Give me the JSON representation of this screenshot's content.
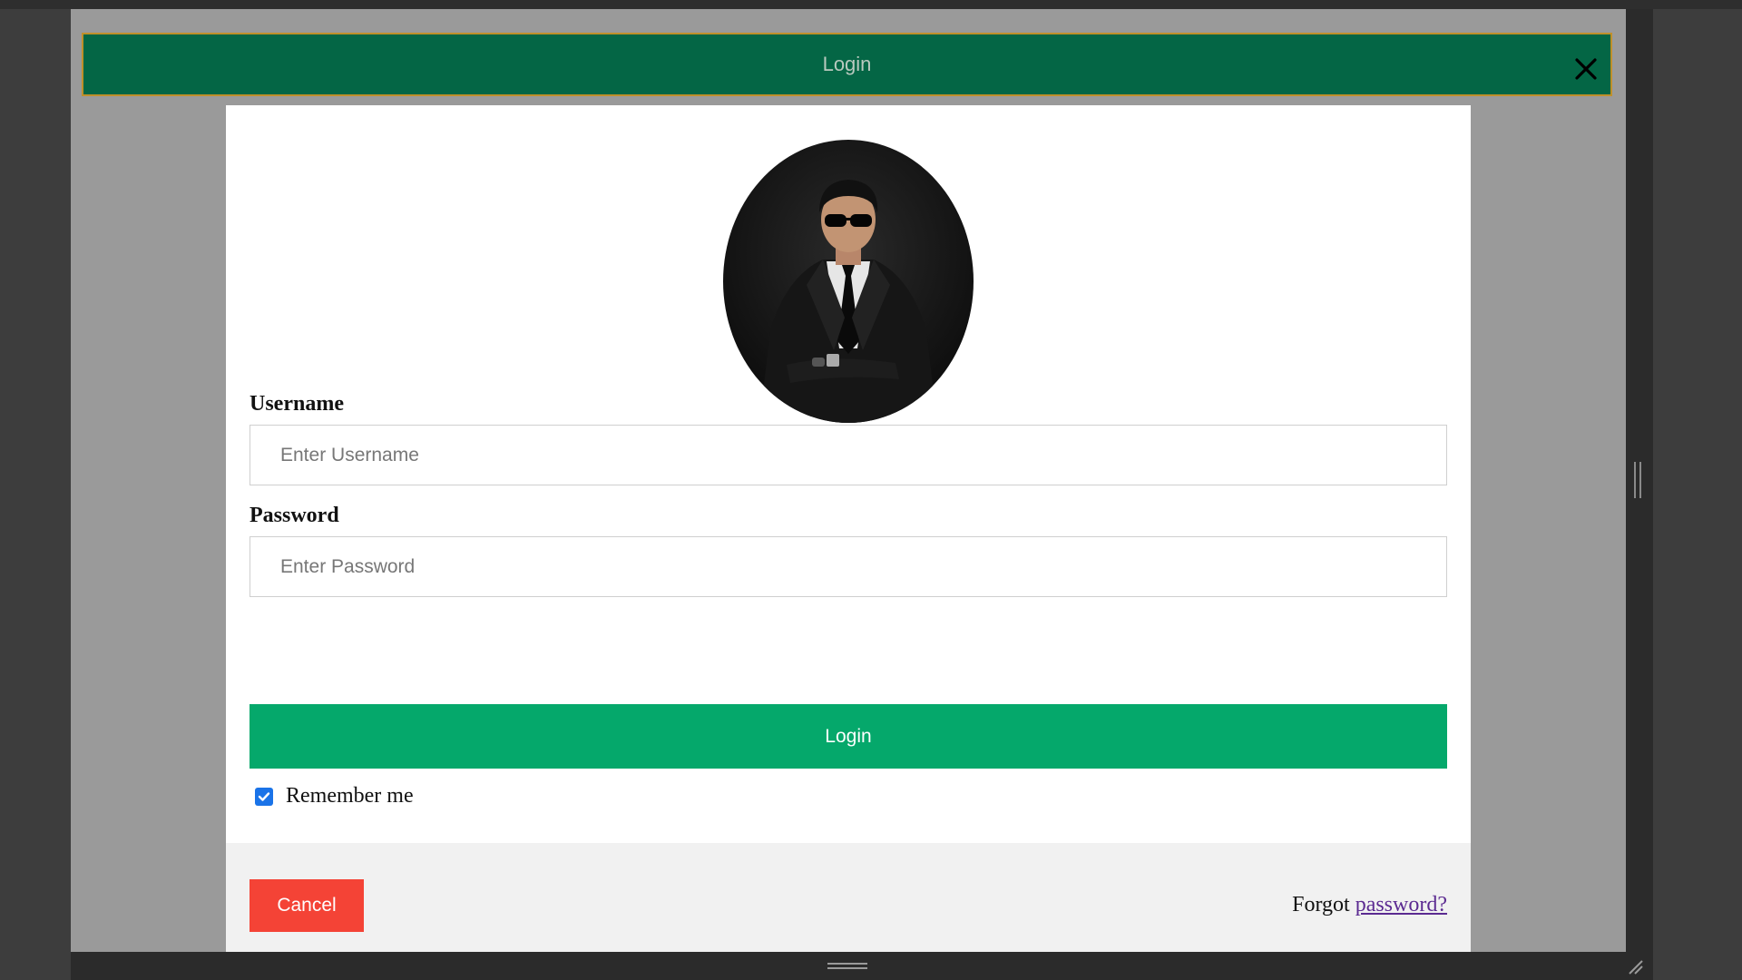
{
  "modal": {
    "header_title": "Login",
    "close_icon": "close-icon"
  },
  "avatar": {
    "icon": "profile-photo"
  },
  "form": {
    "username_label": "Username",
    "username_placeholder": "Enter Username",
    "password_label": "Password",
    "password_placeholder": "Enter Password",
    "login_button": "Login",
    "remember_label": "Remember me",
    "remember_checked": true
  },
  "footer": {
    "cancel_button": "Cancel",
    "forgot_prefix": "Forgot",
    "forgot_link": "password?"
  },
  "colors": {
    "header_bg": "#046645",
    "header_border": "#c0902a",
    "login_button": "#05a86b",
    "cancel_button": "#f44336",
    "link": "#5b2a91"
  }
}
